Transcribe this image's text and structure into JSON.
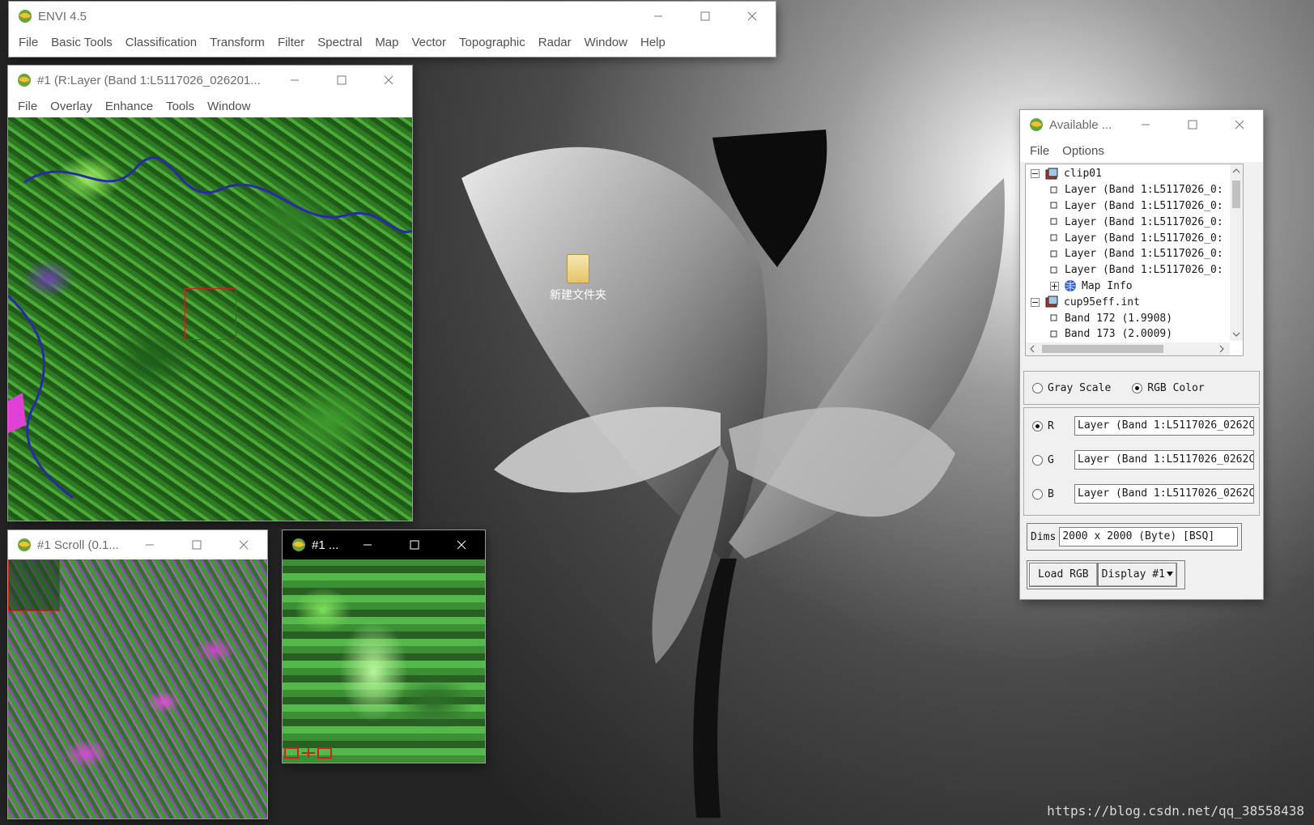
{
  "envi_main": {
    "title": "ENVI 4.5",
    "menu": [
      "File",
      "Basic Tools",
      "Classification",
      "Transform",
      "Filter",
      "Spectral",
      "Map",
      "Vector",
      "Topographic",
      "Radar",
      "Window",
      "Help"
    ]
  },
  "image_window": {
    "title": "#1 (R:Layer (Band 1:L5117026_026201...",
    "menu": [
      "File",
      "Overlay",
      "Enhance",
      "Tools",
      "Window"
    ]
  },
  "scroll_window": {
    "title": "#1 Scroll (0.1..."
  },
  "zoom_window": {
    "title": "#1 ..."
  },
  "desktop_icon": {
    "label": "新建文件夹"
  },
  "bands_window": {
    "title": "Available ...",
    "menu": [
      "File",
      "Options"
    ],
    "tree": [
      {
        "text": "clip01",
        "level": 0,
        "kind": "file",
        "expander": "-"
      },
      {
        "text": "Layer (Band 1:L5117026_0:",
        "level": 1,
        "kind": "band"
      },
      {
        "text": "Layer (Band 1:L5117026_0:",
        "level": 1,
        "kind": "band"
      },
      {
        "text": "Layer (Band 1:L5117026_0:",
        "level": 1,
        "kind": "band"
      },
      {
        "text": "Layer (Band 1:L5117026_0:",
        "level": 1,
        "kind": "band"
      },
      {
        "text": "Layer (Band 1:L5117026_0:",
        "level": 1,
        "kind": "band"
      },
      {
        "text": "Layer (Band 1:L5117026_0:",
        "level": 1,
        "kind": "band"
      },
      {
        "text": "Map Info",
        "level": 1,
        "kind": "map",
        "expander": "+"
      },
      {
        "text": "cup95eff.int",
        "level": 0,
        "kind": "file",
        "expander": "-"
      },
      {
        "text": "Band 172 (1.9908)",
        "level": 1,
        "kind": "band"
      },
      {
        "text": "Band 173 (2.0009)",
        "level": 1,
        "kind": "band"
      }
    ],
    "mode": {
      "gray": "Gray Scale",
      "rgb": "RGB Color",
      "selected": "rgb"
    },
    "channels": [
      {
        "label": "R",
        "value": "Layer (Band 1:L5117026_0262C",
        "selected": true
      },
      {
        "label": "G",
        "value": "Layer (Band 1:L5117026_0262C",
        "selected": false
      },
      {
        "label": "B",
        "value": "Layer (Band 1:L5117026_0262C",
        "selected": false
      }
    ],
    "dims_label": "Dims",
    "dims_value": "2000 x 2000 (Byte) [BSQ]",
    "load_button": "Load RGB",
    "display_button": "Display #1"
  },
  "watermark": "https://blog.csdn.net/qq_38558438",
  "colors": {
    "zoom_box": "#d0201c",
    "title_dark": "#000000"
  }
}
